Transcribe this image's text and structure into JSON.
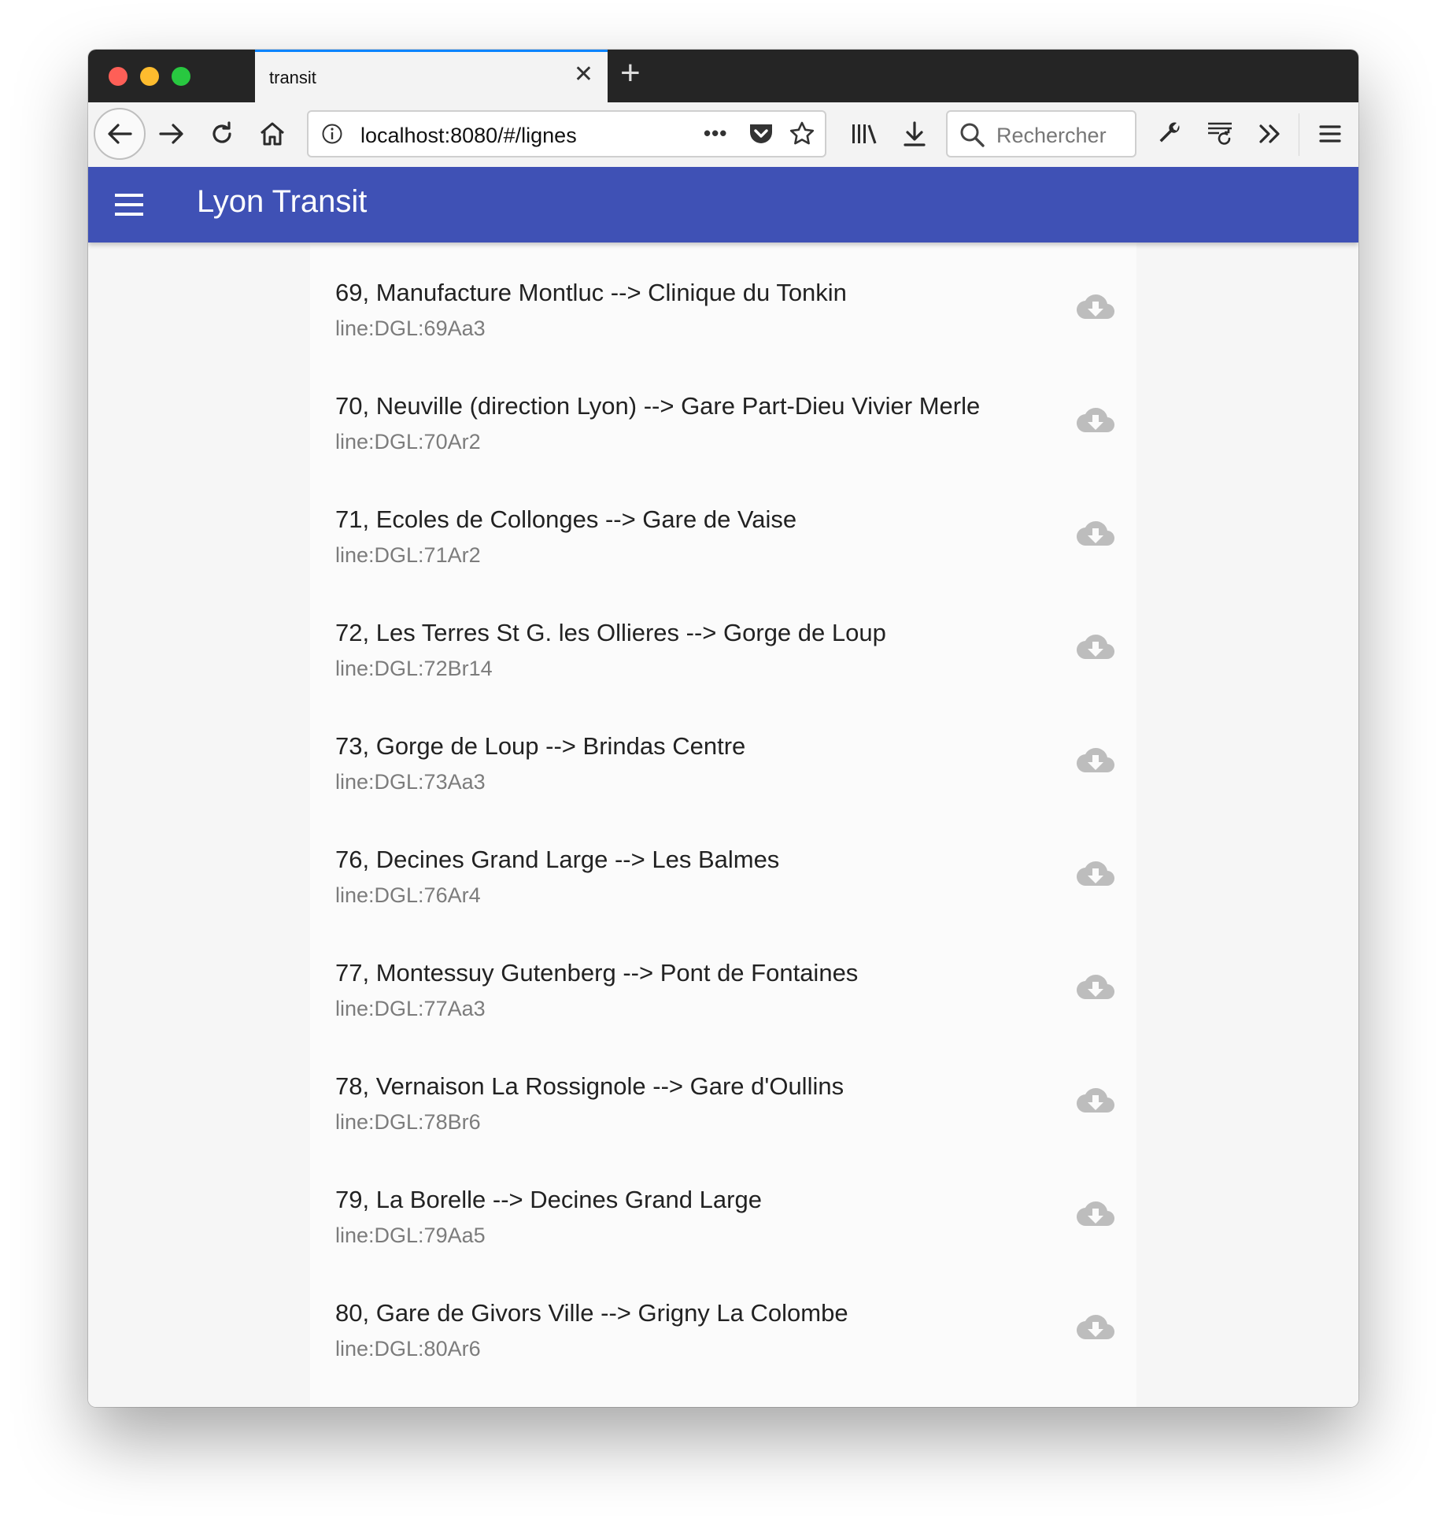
{
  "browser": {
    "tab_title": "transit",
    "tab_close_glyph": "✕",
    "new_tab_glyph": "+",
    "url": "localhost:8080/#/lignes",
    "url_more_glyph": "•••",
    "search_placeholder": "Rechercher",
    "icons": [
      "back-arrow-icon",
      "forward-arrow-icon",
      "reload-icon",
      "home-icon",
      "info-icon",
      "pocket-icon",
      "bookmark-star-icon",
      "library-icon",
      "download-icon",
      "search-icon",
      "wrench-icon",
      "synced-tabs-icon",
      "overflow-chevrons-icon",
      "menu-icon"
    ]
  },
  "app": {
    "title": "Lyon Transit",
    "menu_icon": "hamburger-icon",
    "accent_color": "#3f51b5"
  },
  "lines": [
    {
      "title": "69, Manufacture Montluc --> Clinique du Tonkin",
      "id": "line:DGL:69Aa3"
    },
    {
      "title": "70, Neuville (direction Lyon) --> Gare Part-Dieu Vivier Merle",
      "id": "line:DGL:70Ar2"
    },
    {
      "title": "71, Ecoles de Collonges --> Gare de Vaise",
      "id": "line:DGL:71Ar2"
    },
    {
      "title": "72, Les Terres St G. les Ollieres --> Gorge de Loup",
      "id": "line:DGL:72Br14"
    },
    {
      "title": "73, Gorge de Loup --> Brindas Centre",
      "id": "line:DGL:73Aa3"
    },
    {
      "title": "76, Decines Grand Large --> Les Balmes",
      "id": "line:DGL:76Ar4"
    },
    {
      "title": "77, Montessuy Gutenberg --> Pont de Fontaines",
      "id": "line:DGL:77Aa3"
    },
    {
      "title": "78, Vernaison La Rossignole --> Gare d'Oullins",
      "id": "line:DGL:78Br6"
    },
    {
      "title": "79, La Borelle --> Decines Grand Large",
      "id": "line:DGL:79Aa5"
    },
    {
      "title": "80, Gare de Givors Ville --> Grigny La Colombe",
      "id": "line:DGL:80Ar6"
    }
  ],
  "row_action_icon": "cloud-download-icon"
}
